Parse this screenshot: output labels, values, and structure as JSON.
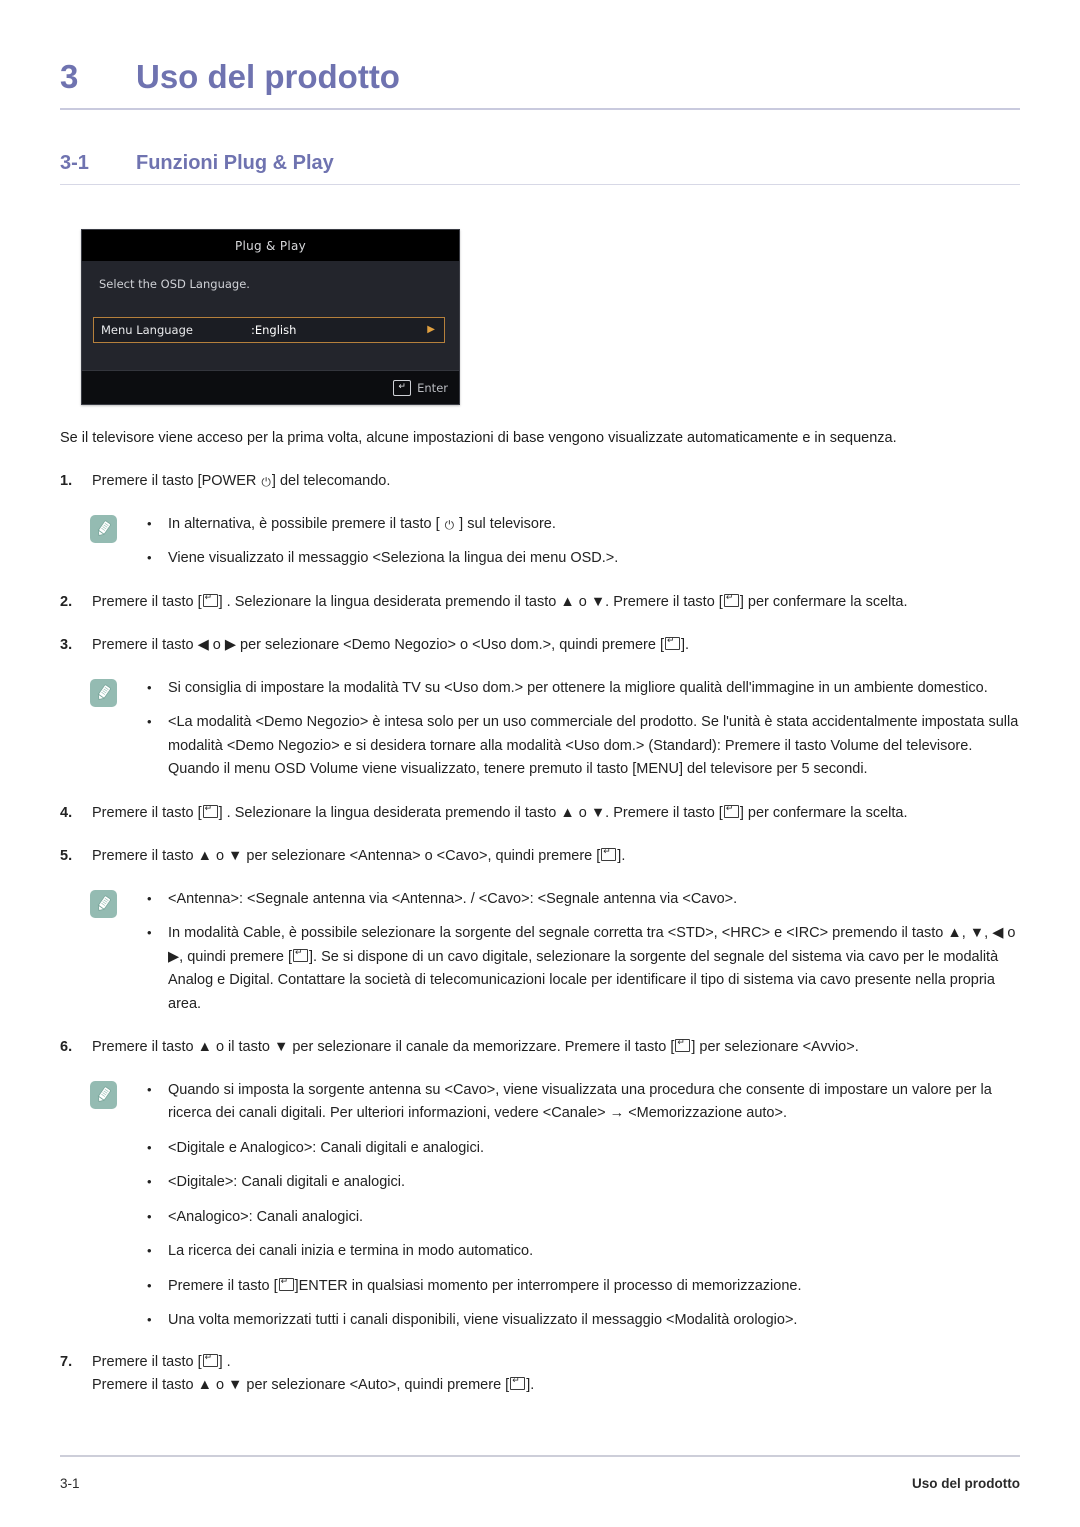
{
  "chapter": {
    "number": "3",
    "title": "Uso del prodotto"
  },
  "section": {
    "number": "3-1",
    "title": "Funzioni Plug & Play"
  },
  "osd": {
    "title": "Plug & Play",
    "subtitle": "Select the OSD Language.",
    "row_label": "Menu Language",
    "row_value": ":English",
    "row_arrow": "▶",
    "footer_key": "↵",
    "footer_label": "Enter"
  },
  "intro": "Se il televisore viene acceso per la prima volta, alcune impostazioni di base vengono visualizzate automaticamente e in sequenza.",
  "steps": {
    "s1": {
      "num": "1.",
      "pre": "Premere il tasto [POWER ",
      "post": "] del telecomando."
    },
    "s2": {
      "num": "2.",
      "pre": "Premere il tasto [",
      "mid": "] . Selezionare la lingua desiderata premendo il tasto ▲ o ▼. Premere il tasto [",
      "post": "] per confermare la scelta."
    },
    "s3": {
      "num": "3.",
      "pre": "Premere il tasto ◀ o ▶ per selezionare <Demo Negozio> o <Uso dom.>, quindi premere [",
      "post": "]."
    },
    "s4": {
      "num": "4.",
      "pre": "Premere il tasto [",
      "mid": "] . Selezionare la lingua desiderata premendo il tasto ▲ o ▼. Premere il tasto [",
      "post": "] per confermare la scelta."
    },
    "s5": {
      "num": "5.",
      "pre": "Premere il tasto ▲ o ▼ per selezionare <Antenna> o <Cavo>, quindi premere [",
      "post": "]."
    },
    "s6": {
      "num": "6.",
      "pre": "Premere il tasto ▲ o il tasto ▼ per selezionare il canale da memorizzare. Premere il tasto [",
      "post": "] per selezionare <Avvio>."
    },
    "s7": {
      "num": "7.",
      "pre": "Premere il tasto [",
      "post": "] .",
      "line2_pre": "Premere il tasto ▲ o ▼ per selezionare <Auto>, quindi premere [",
      "line2_post": "]."
    }
  },
  "note1": {
    "bullets": [
      {
        "pre": "In alternativa, è possibile premere il tasto [ ",
        "post": " ] sul televisore.",
        "has_power_icon": true
      },
      {
        "text": "Viene visualizzato il messaggio <Seleziona la lingua dei menu OSD.>."
      }
    ]
  },
  "note2": {
    "bullets": [
      {
        "text": "Si consiglia di impostare la modalità TV su <Uso dom.> per ottenere la migliore qualità dell'immagine in un ambiente domestico."
      },
      {
        "text": "<La modalità <Demo Negozio> è intesa solo per un uso commerciale del prodotto. Se l'unità è stata accidentalmente impostata sulla modalità <Demo Negozio> e si desidera tornare alla modalità <Uso dom.> (Standard): Premere il tasto Volume del televisore. Quando il menu OSD Volume viene visualizzato, tenere premuto il tasto [MENU] del televisore per 5 secondi."
      }
    ]
  },
  "note3": {
    "b1": "<Antenna>: <Segnale antenna via <Antenna>. / <Cavo>: <Segnale antenna via <Cavo>.",
    "b2_pre": "In modalità Cable, è possibile selezionare la sorgente del segnale corretta tra <STD>, <HRC> e <IRC> premendo il tasto ▲, ▼, ◀ o ▶, quindi premere [",
    "b2_post": "]. Se si dispone di un cavo digitale, selezionare la sorgente del segnale del sistema via cavo per le modalità Analog e Digital. Contattare la società di telecomunicazioni locale per identificare il tipo di sistema via cavo presente nella propria area."
  },
  "note4": {
    "b1": "Quando si imposta la sorgente antenna su <Cavo>, viene visualizzata una procedura che consente di impostare un valore per la ricerca dei canali digitali. Per ulteriori informazioni, vedere <Canale> → <Memorizzazione auto>.",
    "extra": [
      "<Digitale e Analogico>: Canali digitali e analogici.",
      "<Digitale>: Canali digitali e analogici.",
      "<Analogico>: Canali analogici.",
      "La ricerca dei canali inizia e termina in modo automatico."
    ],
    "b_enter_pre": "Premere il tasto [",
    "b_enter_post": "]ENTER in qualsiasi momento per interrompere il processo di memorizzazione.",
    "b_last": "Una volta memorizzati tutti i canali disponibili, viene visualizzato il messaggio <Modalità orologio>."
  },
  "bullet_char": "•",
  "footer": {
    "left": "3-1",
    "right": "Uso del prodotto"
  },
  "colors": {
    "heading": "#6f73b0",
    "note_icon_bg": "#94bbb2",
    "osd_highlight_border": "#b5803c",
    "osd_bg": "#23252c"
  }
}
